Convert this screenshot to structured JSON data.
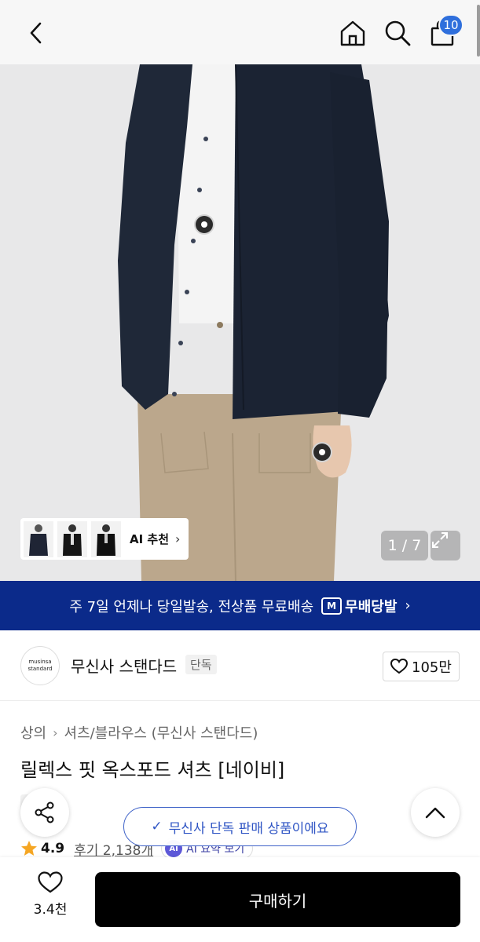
{
  "header": {
    "back_icon": "chevron-left-icon",
    "home_icon": "home-icon",
    "search_icon": "search-icon",
    "bag_icon": "shopping-bag-icon",
    "bag_badge": "10",
    "badge_color": "#2f6fdc"
  },
  "gallery": {
    "ai_recommend_label": "AI 추천",
    "page_counter": "1 / 7",
    "expand_icon": "expand-icon"
  },
  "banner": {
    "text": "주 7일 언제나 당일발송, 전상품 무료배송",
    "logo_mark": "M",
    "logo_text": "무배당발",
    "color": "#0b2a8a"
  },
  "brand": {
    "logo_line1": "musinsa",
    "logo_line2": "standard",
    "name": "무신사 스탠다드",
    "tag": "단독",
    "like_count": "105만"
  },
  "product": {
    "breadcrumb": [
      "상의",
      "셔츠/블라우스 (무신사 스탠다드)"
    ],
    "title": "릴렉스 핏 옥스포드 셔츠 [네이비]",
    "exclusive_tag": "단독",
    "rating": "4.9",
    "reviews": "후기 2,138개",
    "ai_summary_badge": "AI",
    "ai_summary": "AI 요약 보기",
    "star_color": "#f5a623"
  },
  "toast": {
    "text": "무신사 단독 판매 상품이에요"
  },
  "bottom": {
    "fav_count": "3.4천",
    "buy_label": "구매하기"
  }
}
